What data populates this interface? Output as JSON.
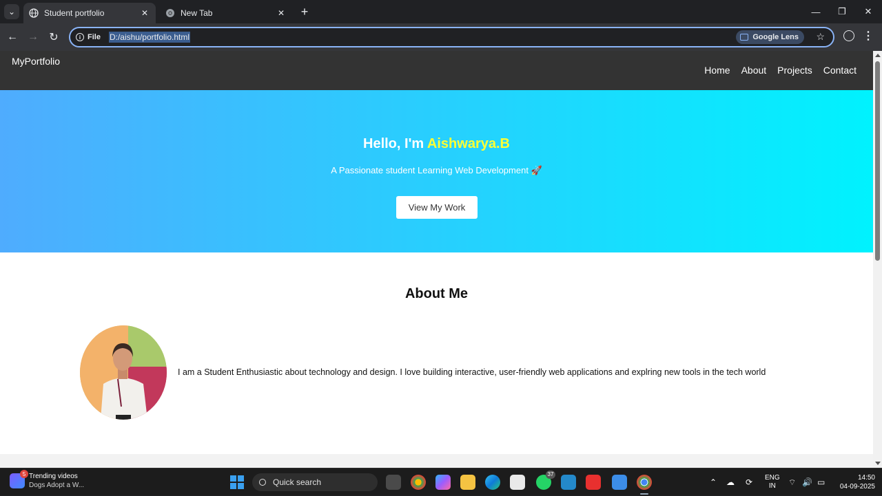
{
  "browser": {
    "tabs": [
      {
        "title": "Student portfolio",
        "active": true
      },
      {
        "title": "New Tab",
        "active": false
      }
    ],
    "new_tab_glyph": "+",
    "omnibox": {
      "chip_label": "File",
      "url": "D:/aishu/portfolio.html",
      "lens_label": "Google Lens"
    }
  },
  "site": {
    "logo": "MyPortfolio",
    "nav": [
      "Home",
      "About",
      "Projects",
      "Contact"
    ],
    "hero": {
      "greeting": "Hello, I'm ",
      "name": "Aishwarya.B",
      "tagline": "A Passionate student Learning Web Development 🚀",
      "cta": "View My Work"
    },
    "about": {
      "title": "About Me",
      "text": "I am a Student Enthusiastic about technology and design. I love building interactive, user-friendly web applications and explring new tools in the tech world"
    }
  },
  "taskbar": {
    "widget_title": "Trending videos",
    "widget_subtitle": "Dogs Adopt a W...",
    "widget_badge": "5",
    "search_label": "Quick search",
    "whatsapp_count": "37",
    "lang_top": "ENG",
    "lang_bottom": "IN",
    "time": "14:50",
    "date": "04-09-2025"
  },
  "colors": {
    "hero_start": "#4facfe",
    "hero_end": "#00f2fe",
    "name_highlight": "#ffff33",
    "site_nav_bg": "#333333"
  }
}
